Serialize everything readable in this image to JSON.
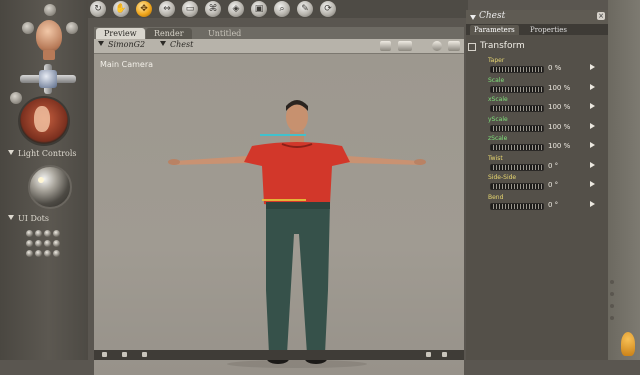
{
  "document": {
    "tabs": [
      "Preview",
      "Render",
      "Untitled"
    ],
    "figure_menu": "SimonG2",
    "actor_menu": "Chest",
    "camera_label": "Main Camera"
  },
  "left_panel": {
    "light_controls_label": "Light Controls",
    "ui_dots_label": "UI Dots"
  },
  "toolbar": {
    "icons": [
      "rotate-icon",
      "pose-icon",
      "translate-icon",
      "scale-icon",
      "taper-icon",
      "chain-break-icon",
      "color-icon",
      "grouping-icon",
      "view-magnifier-icon",
      "morph-brush-icon",
      "direct-manipulation-icon"
    ],
    "active_index": 2
  },
  "palette": {
    "title": "Chest",
    "tabs": [
      "Parameters",
      "Properties"
    ],
    "section": "Transform",
    "params": [
      {
        "name": "Taper",
        "value": "0 %",
        "color": "#e8d770"
      },
      {
        "name": "Scale",
        "value": "100 %",
        "color": "#7fe07a"
      },
      {
        "name": "xScale",
        "value": "100 %",
        "color": "#7fe07a"
      },
      {
        "name": "yScale",
        "value": "100 %",
        "color": "#7fe07a"
      },
      {
        "name": "zScale",
        "value": "100 %",
        "color": "#7fe07a"
      },
      {
        "name": "Twist",
        "value": "0 °",
        "color": "#e8d770"
      },
      {
        "name": "Side-Side",
        "value": "0 °",
        "color": "#e8d770"
      },
      {
        "name": "Bend",
        "value": "0 °",
        "color": "#e8d770"
      }
    ]
  },
  "colors": {
    "viewport_bg": "#9d988f",
    "shirt": "#d2372a",
    "jeans": "#36514a",
    "active_tool": "#f1a71c"
  }
}
